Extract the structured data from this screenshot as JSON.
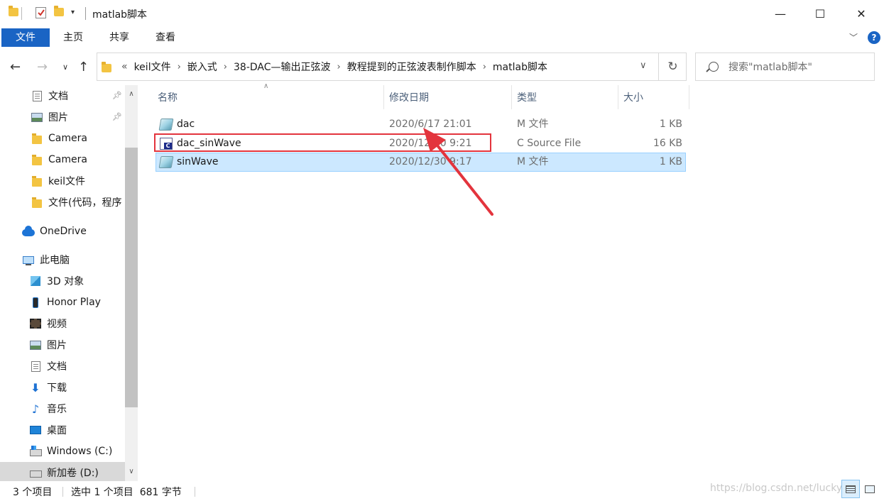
{
  "window": {
    "title": "matlab脚本",
    "minimize_glyph": "—",
    "maximize_glyph": "☐",
    "close_glyph": "✕"
  },
  "ribbon": {
    "tabs": [
      "文件",
      "主页",
      "共享",
      "查看"
    ],
    "help": "?"
  },
  "address": {
    "overflow": "«",
    "crumbs": [
      "keil文件",
      "嵌入式",
      "38-DAC—输出正弦波",
      "教程提到的正弦波表制作脚本",
      "matlab脚本"
    ]
  },
  "search": {
    "placeholder": "搜索\"matlab脚本\""
  },
  "sidebar": {
    "items": [
      {
        "label": "文档",
        "icon": "document-icon",
        "pinned": true
      },
      {
        "label": "图片",
        "icon": "picture-icon",
        "pinned": true
      },
      {
        "label": "Camera",
        "icon": "folder-icon"
      },
      {
        "label": "Camera",
        "icon": "folder-icon"
      },
      {
        "label": "keil文件",
        "icon": "folder-icon"
      },
      {
        "label": "文件(代码，程序",
        "icon": "folder-icon"
      },
      {
        "label": "OneDrive",
        "icon": "onedrive-icon"
      },
      {
        "label": "此电脑",
        "icon": "this-pc-icon"
      },
      {
        "label": "3D 对象",
        "icon": "3d-objects-icon"
      },
      {
        "label": "Honor Play",
        "icon": "phone-icon"
      },
      {
        "label": "视频",
        "icon": "video-icon"
      },
      {
        "label": "图片",
        "icon": "picture-icon"
      },
      {
        "label": "文档",
        "icon": "document-icon"
      },
      {
        "label": "下载",
        "icon": "download-icon"
      },
      {
        "label": "音乐",
        "icon": "music-icon"
      },
      {
        "label": "桌面",
        "icon": "desktop-icon"
      },
      {
        "label": "Windows (C:)",
        "icon": "windows-drive-icon"
      },
      {
        "label": "新加卷 (D:)",
        "icon": "drive-icon",
        "selected": true
      }
    ]
  },
  "columns": {
    "name": "名称",
    "date": "修改日期",
    "type": "类型",
    "size": "大小"
  },
  "files": [
    {
      "name": "dac",
      "date": "2020/6/17 21:01",
      "type": "M 文件",
      "size": "1 KB",
      "icon": "m-file-icon"
    },
    {
      "name": "dac_sinWave",
      "date": "2020/12/30 9:21",
      "type": "C Source File",
      "size": "16 KB",
      "icon": "c-file-icon"
    },
    {
      "name": "sinWave",
      "date": "2020/12/30 9:17",
      "type": "M 文件",
      "size": "1 KB",
      "icon": "m-file-icon",
      "selected": true
    }
  ],
  "status": {
    "count": "3 个项目",
    "selection": "选中 1 个项目  681 字节"
  },
  "watermark": "https://blog.csdn.net/lucky",
  "colors": {
    "accent": "#1a64c4",
    "selection": "#cce8ff",
    "annotation": "#e3343d"
  }
}
